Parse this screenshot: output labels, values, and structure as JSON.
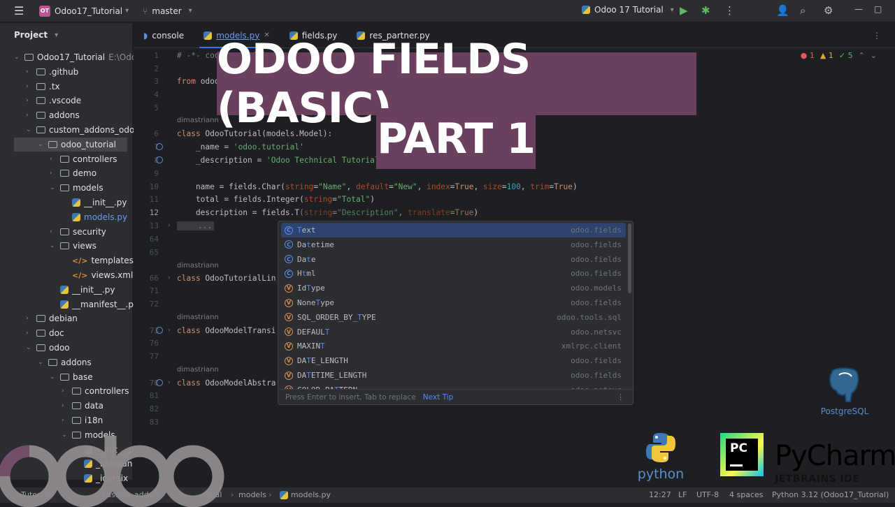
{
  "titlebar": {
    "project_badge": "OT",
    "project_name": "Odoo17_Tutorial",
    "branch": "master",
    "run_config": "Odoo 17 Tutorial"
  },
  "project_panel": {
    "header": "Project",
    "tree": [
      {
        "label": "Odoo17_Tutorial",
        "extra": "E:\\Odo",
        "type": "folder",
        "arrow": "down",
        "indent": 0
      },
      {
        "label": ".github",
        "type": "folder",
        "arrow": "right",
        "indent": 1
      },
      {
        "label": ".tx",
        "type": "folder",
        "arrow": "right",
        "indent": 1
      },
      {
        "label": ".vscode",
        "type": "folder",
        "arrow": "right",
        "indent": 1
      },
      {
        "label": "addons",
        "type": "folder",
        "arrow": "right",
        "indent": 1
      },
      {
        "label": "custom_addons_odoo1",
        "type": "folder",
        "arrow": "down",
        "indent": 1
      },
      {
        "label": "odoo_tutorial",
        "type": "folder",
        "arrow": "down",
        "indent": 2,
        "selected": true
      },
      {
        "label": "controllers",
        "type": "folder",
        "arrow": "right",
        "indent": 3
      },
      {
        "label": "demo",
        "type": "folder",
        "arrow": "right",
        "indent": 3
      },
      {
        "label": "models",
        "type": "folder",
        "arrow": "down",
        "indent": 3
      },
      {
        "label": "__init__.py",
        "type": "py",
        "arrow": "",
        "indent": 4
      },
      {
        "label": "models.py",
        "type": "py",
        "arrow": "",
        "indent": 4,
        "highlight": true
      },
      {
        "label": "security",
        "type": "folder",
        "arrow": "right",
        "indent": 3
      },
      {
        "label": "views",
        "type": "folder",
        "arrow": "down",
        "indent": 3
      },
      {
        "label": "templates.xm",
        "type": "xml",
        "arrow": "",
        "indent": 4
      },
      {
        "label": "views.xml",
        "type": "xml",
        "arrow": "",
        "indent": 4
      },
      {
        "label": "__init__.py",
        "type": "py",
        "arrow": "",
        "indent": 3
      },
      {
        "label": "__manifest__.py",
        "type": "py",
        "arrow": "",
        "indent": 3
      },
      {
        "label": "debian",
        "type": "folder",
        "arrow": "right",
        "indent": 1
      },
      {
        "label": "doc",
        "type": "folder",
        "arrow": "right",
        "indent": 1
      },
      {
        "label": "odoo",
        "type": "folder",
        "arrow": "down",
        "indent": 1
      },
      {
        "label": "addons",
        "type": "folder",
        "arrow": "down",
        "indent": 2
      },
      {
        "label": "base",
        "type": "folder",
        "arrow": "down",
        "indent": 3
      },
      {
        "label": "controllers",
        "type": "folder",
        "arrow": "right",
        "indent": 4
      },
      {
        "label": "data",
        "type": "folder",
        "arrow": "right",
        "indent": 4
      },
      {
        "label": "i18n",
        "type": "folder",
        "arrow": "right",
        "indent": 4
      },
      {
        "label": "models",
        "type": "folder",
        "arrow": "down",
        "indent": 4
      },
      {
        "label": "__init__.py",
        "type": "py",
        "arrow": "",
        "indent": 5
      },
      {
        "label": "_ideskun",
        "type": "py",
        "arrow": "",
        "indent": 5
      },
      {
        "label": "_ioomix",
        "type": "py",
        "arrow": "",
        "indent": 5
      }
    ]
  },
  "tabs": [
    {
      "label": "console",
      "active": false
    },
    {
      "label": "models.py",
      "active": true
    },
    {
      "label": "fields.py",
      "active": false
    },
    {
      "label": "res_partner.py",
      "active": false
    }
  ],
  "inspections": {
    "errors": "1",
    "warnings": "1",
    "ok": "5"
  },
  "code": {
    "line1": "# -*- coding: utf-8 -*-",
    "line3": "from odoo import models, fields",
    "author": "dimastriann",
    "author_star": "dimastriann *",
    "line6_kw": "class",
    "line6_rest": " OdooTutorial(models.Model):",
    "line7_a": "    _name = ",
    "line7_s": "'odoo.tutorial'",
    "line8_a": "    _description = ",
    "line8_s": "'Odoo Technical Tutorial'",
    "line10_a": "    name = fields.Char(",
    "line10_p1": "string",
    "line10_s1": "\"Name\"",
    "line10_p2": "default",
    "line10_s2": "\"New\"",
    "line10_p3": "index",
    "line10_v3": "True",
    "line10_p4": "size",
    "line10_v4": "100",
    "line10_p5": "trim",
    "line10_v5": "True",
    "line11_a": "    total = fields.Integer(",
    "line11_p": "string",
    "line11_s": "\"Total\"",
    "line12_a": "    description = fields.T",
    "line12_p1": "string",
    "line12_s1": "\"Description\"",
    "line12_p2": "translate",
    "line12_v2": "True",
    "line13": "    ...",
    "line66_rest": " OdooTutorialLin",
    "line73_rest": " OdooModelTransi",
    "line78_rest": " OdooModelAbstra"
  },
  "line_numbers": [
    "1",
    "2",
    "3",
    "4",
    "5",
    "6",
    "7",
    "8",
    "9",
    "10",
    "11",
    "12",
    "13",
    "64",
    "65",
    "66",
    "71",
    "72",
    "73",
    "76",
    "77",
    "78",
    "81",
    "82",
    "83"
  ],
  "completion": {
    "items": [
      {
        "prefix": "",
        "match": "T",
        "rest": "ext",
        "kind": "c",
        "module": "odoo.fields",
        "selected": true
      },
      {
        "prefix": "Da",
        "match": "t",
        "rest": "etime",
        "kind": "c",
        "module": "odoo.fields"
      },
      {
        "prefix": "Da",
        "match": "t",
        "rest": "e",
        "kind": "c",
        "module": "odoo.fields"
      },
      {
        "prefix": "H",
        "match": "t",
        "rest": "ml",
        "kind": "c",
        "module": "odoo.fields"
      },
      {
        "prefix": "Id",
        "match": "T",
        "rest": "ype",
        "kind": "v",
        "module": "odoo.models"
      },
      {
        "prefix": "None",
        "match": "T",
        "rest": "ype",
        "kind": "v",
        "module": "odoo.fields"
      },
      {
        "prefix": "SQL_ORDER_BY_",
        "match": "T",
        "rest": "YPE",
        "kind": "v",
        "module": "odoo.tools.sql"
      },
      {
        "prefix": "DEFAUL",
        "match": "T",
        "rest": "",
        "kind": "v",
        "module": "odoo.netsvc"
      },
      {
        "prefix": "MAXIN",
        "match": "T",
        "rest": "",
        "kind": "v",
        "module": "xmlrpc.client"
      },
      {
        "prefix": "DA",
        "match": "T",
        "rest": "E_LENGTH",
        "kind": "v",
        "module": "odoo.fields"
      },
      {
        "prefix": "DA",
        "match": "T",
        "rest": "ETIME_LENGTH",
        "kind": "v",
        "module": "odoo.fields"
      },
      {
        "prefix": "COLOR_PA",
        "match": "T",
        "rest": "TERN",
        "kind": "v",
        "module": "odoo.netsvc"
      }
    ],
    "footer": "Press Enter to insert, Tab to replace",
    "next_tip": "Next Tip"
  },
  "banner": {
    "line1": "ODOO FIELDS (BASIC)",
    "line2": "PART 1"
  },
  "statusbar": {
    "breadcrumb_1": "Tutorial",
    "breadcrumb_2": "custom_addo",
    "breadcrumb_3": "7",
    "breadcrumb_4": "rial",
    "breadcrumb_5": "models",
    "breadcrumb_6": "models.py",
    "position": "12:27",
    "line_sep": "LF",
    "encoding": "UTF-8",
    "indent": "4 spaces",
    "interpreter": "Python 3.12 (Odoo17_Tutorial)"
  },
  "logos": {
    "odoo": "odoo",
    "postgres": "PostgreSQL",
    "python": "python",
    "pycharm_badge": "PC",
    "pycharm": "PyCharm",
    "jetbrains": "JETBRAINS IDE"
  },
  "colors": {
    "accent": "#3574f0",
    "banner": "#6b3f5e",
    "keyword": "#cf8e6d",
    "string": "#6aab73"
  }
}
